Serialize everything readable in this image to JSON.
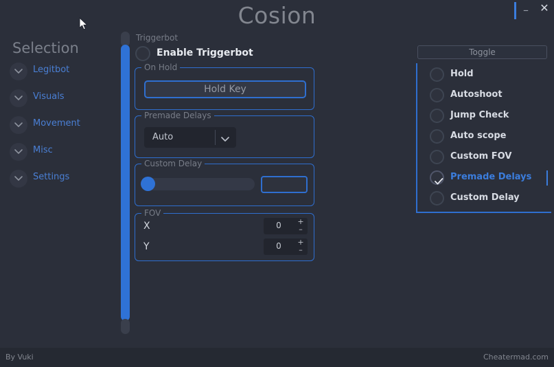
{
  "window": {
    "title": "Cosion",
    "minimize_label": "–",
    "close_label": "✕"
  },
  "sidebar": {
    "title": "Selection",
    "items": [
      {
        "label": "Legitbot",
        "icon": "chevron-down-icon"
      },
      {
        "label": "Visuals",
        "icon": "chevron-down-icon"
      },
      {
        "label": "Movement",
        "icon": "chevron-down-icon"
      },
      {
        "label": "Misc",
        "icon": "chevron-down-icon"
      },
      {
        "label": "Settings",
        "icon": "chevron-down-icon"
      }
    ]
  },
  "main": {
    "panel_legend": "Triggerbot",
    "enable": {
      "label": "Enable Triggerbot",
      "checked": false
    },
    "on_hold": {
      "legend": "On Hold",
      "hold_key_label": "Hold Key"
    },
    "premade_delays": {
      "legend": "Premade Delays",
      "selected": "Auto",
      "chevron": "chevron-down-icon"
    },
    "custom_delay": {
      "legend": "Custom Delay",
      "slider_value": 0,
      "slider_min": 0,
      "slider_max": 100,
      "input_value": ""
    },
    "fov": {
      "legend": "FOV",
      "x_label": "X",
      "x_value": "0",
      "y_label": "Y",
      "y_value": "0",
      "increment_label": "+",
      "decrement_label": "–"
    }
  },
  "right_panel": {
    "toggle_label": "Toggle",
    "items": [
      {
        "label": "Hold",
        "checked": false
      },
      {
        "label": "Autoshoot",
        "checked": false
      },
      {
        "label": "Jump Check",
        "checked": false
      },
      {
        "label": "Auto scope",
        "checked": false
      },
      {
        "label": "Custom FOV",
        "checked": false
      },
      {
        "label": "Premade Delays",
        "checked": true
      },
      {
        "label": "Custom Delay",
        "checked": false
      }
    ]
  },
  "footer": {
    "left": "By Vuki",
    "right": "Cheatermad.com"
  },
  "colors": {
    "background": "#2b2f3a",
    "accent_blue": "#2f6fd0",
    "label_blue": "#3b7ddd",
    "footer_bg": "#252932",
    "muted_text": "#82868f"
  }
}
